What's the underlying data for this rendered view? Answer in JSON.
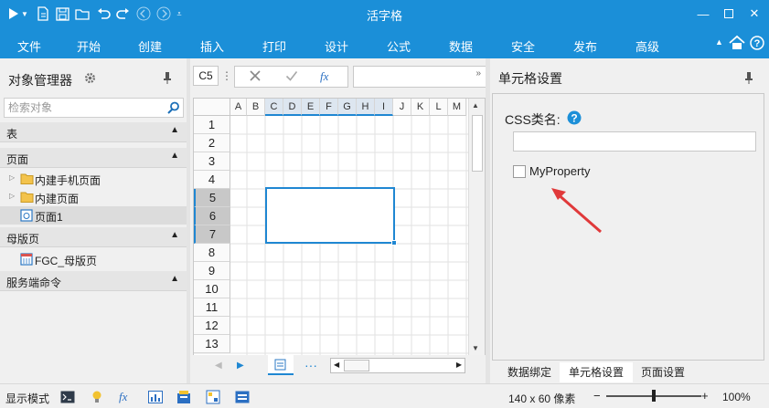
{
  "titlebar": {
    "title": "活字格"
  },
  "menu": [
    "文件",
    "开始",
    "创建",
    "插入",
    "打印",
    "设计",
    "公式",
    "数据",
    "安全",
    "发布",
    "高级"
  ],
  "left_panel": {
    "title": "对象管理器",
    "search_placeholder": "检索对象",
    "sections": {
      "tables": "表",
      "pages": "页面",
      "master_pages": "母版页",
      "server_commands": "服务端命令"
    },
    "page_items": [
      "内建手机页面",
      "内建页面",
      "页面1"
    ],
    "master_items": [
      "FGC_母版页"
    ]
  },
  "formula_bar": {
    "cell_ref": "C5",
    "fx": "fx"
  },
  "sheet": {
    "columns": [
      "A",
      "B",
      "C",
      "D",
      "E",
      "F",
      "G",
      "H",
      "I",
      "J",
      "K",
      "L",
      "M"
    ],
    "rows": [
      "1",
      "2",
      "3",
      "4",
      "5",
      "6",
      "7",
      "8",
      "9",
      "10",
      "11",
      "12",
      "13"
    ]
  },
  "right_panel": {
    "title": "单元格设置",
    "css_label": "CSS类名:",
    "css_value": "",
    "checkbox_label": "MyProperty",
    "checkbox_checked": false,
    "tabs": [
      "数据绑定",
      "单元格设置",
      "页面设置"
    ],
    "active_tab": "单元格设置"
  },
  "statusbar": {
    "mode": "显示模式",
    "size": "140 x 60 像素",
    "zoom": "100%",
    "zoom_fraction": 0.5
  },
  "colors": {
    "brand": "#1b8fd8",
    "selection": "#1f87d2",
    "arrow": "#e0393a"
  }
}
